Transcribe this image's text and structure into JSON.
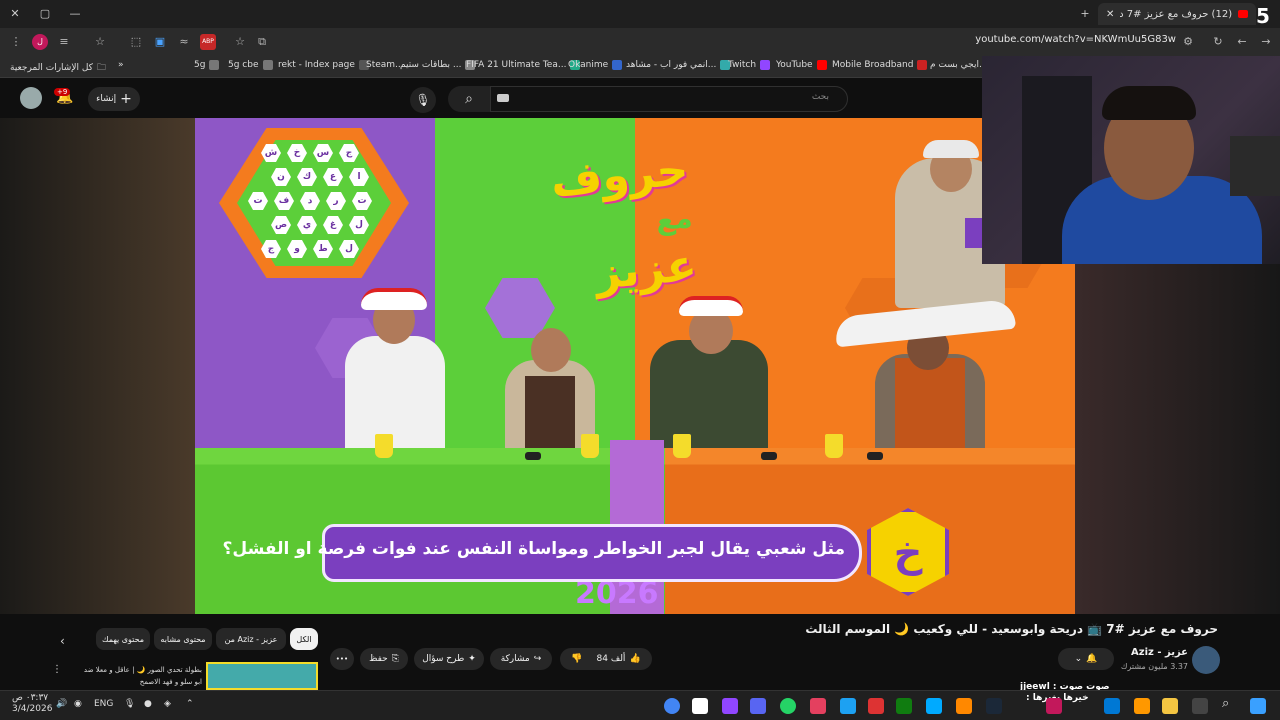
{
  "browser": {
    "active_tab_title": "(12) حروف مع عزيز #7 د",
    "url": "youtube.com/watch?v=NKWmUu5G83w",
    "window_controls": [
      "✕",
      "▢",
      "—"
    ],
    "new_tab_symbol": "+"
  },
  "bookmarks": {
    "all_bookmarks": "كل الإشارات المرجعية",
    "items": [
      "ايجي بست م...",
      "Mobile Broadband",
      "YouTube",
      "Twitch",
      "انمي فور اب - مشاهد...",
      "Okanime",
      "FIFA 21 Ultimate Tea...",
      "بطاقات ستيم ...",
      "Steam...",
      "rekt - Index page",
      "5g cbe",
      "5g"
    ]
  },
  "youtube_header": {
    "search_placeholder": "بحث",
    "create_label": "إنشاء",
    "notifications_count": "+9"
  },
  "video": {
    "logo_line1": "حروف",
    "logo_line2": "مع",
    "logo_line3": "عزيز",
    "board_letters": [
      "ش",
      "خ",
      "س",
      "ج",
      "ن",
      "ك",
      "ع",
      "ا",
      "ت",
      "ف",
      "د",
      "ر",
      "ت",
      "ص",
      "ي",
      "غ",
      "ل",
      "ج",
      "و",
      "ط",
      "ل"
    ],
    "question_letter": "خ",
    "question_text": "مثل شعبي يقال لجبر الخواطر ومواساة النفس عند فوات فرصة او الفشل؟",
    "year": "2026"
  },
  "webcam": {
    "corner_number": "5"
  },
  "below_video": {
    "title": "حروف مع عزيز #7 📺 دريحة وابوسعيد - للي وكعيب 🌙 الموسم الثالث",
    "channel_name": "Aziz - عزيز",
    "subscribers": "3.37 مليون مشترك",
    "likes": "84 ألف",
    "share_label": "مشاركة",
    "ask_label": "طرح سؤال",
    "save_label": "حفظ",
    "more_label": "•••",
    "chips": [
      "الكل",
      "من Aziz - عزيز",
      "محتوى مشابه",
      "محتوى يهمك"
    ],
    "rec_title_line1": "بطولة تحدي الصور 🌙 | عاقل و معلا ضد",
    "rec_title_line2": "ابو سلو و فهد الاصمخ"
  },
  "chat_overlay": {
    "line1": "صوت صوت : jjeewl",
    "line2": "خيرها بغيرها :"
  },
  "taskbar": {
    "time": "٠٣:٣٧ ص",
    "date": "3/4/2026",
    "language": "ENG"
  }
}
